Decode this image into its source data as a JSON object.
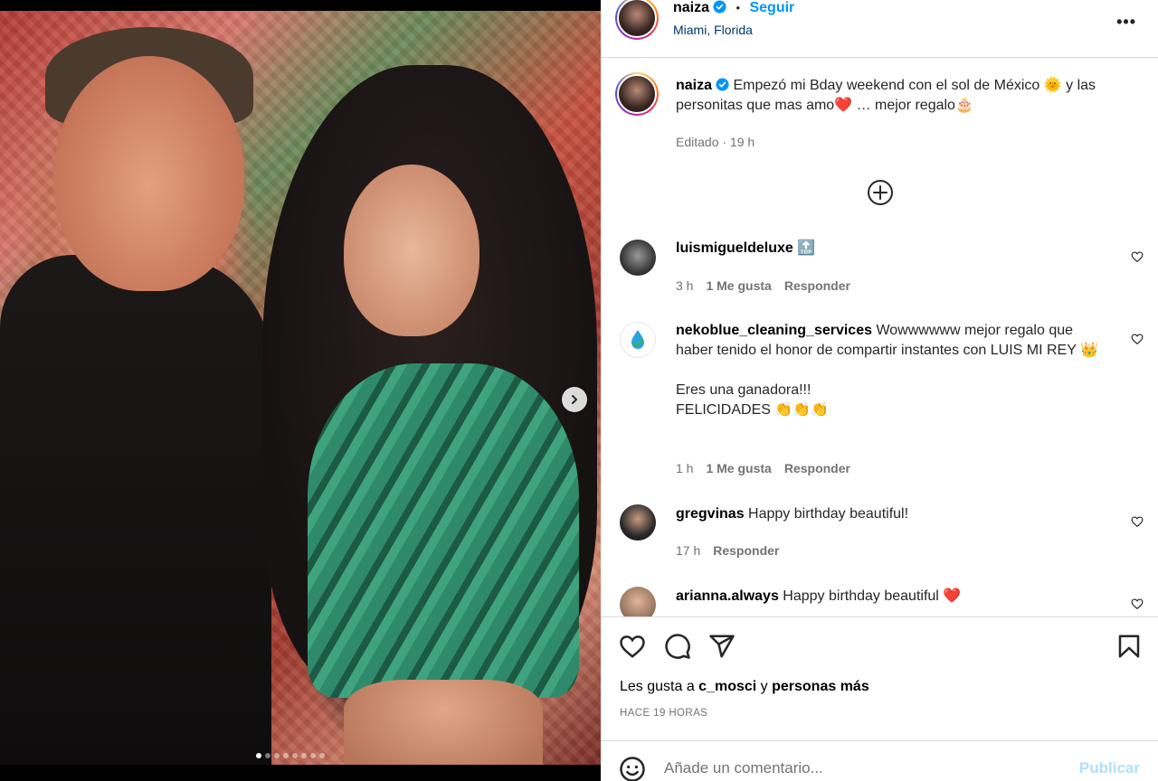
{
  "post": {
    "username": "naiza",
    "follow_label": "Seguir",
    "separator": "•",
    "location": "Miami, Florida",
    "more_label": "•••",
    "caption_username": "naiza",
    "caption_text": "Empezó mi Bday weekend con el sol de México 🌞 y las personitas que mas amo❤️ … mejor regalo🎂",
    "caption_meta": "Editado · 19 h",
    "load_more_icon": "plus-circle-icon",
    "media_slides": 8,
    "media_active_slide": 1
  },
  "comments": [
    {
      "username": "luismigueldeluxe",
      "text": "🔝",
      "time": "3 h",
      "likes": "1 Me gusta",
      "reply": "Responder"
    },
    {
      "username": "nekoblue_cleaning_services",
      "text": "Wowwwwww mejor regalo que haber tenido el honor de compartir instantes con LUIS MI REY 👑",
      "text2": "Eres una ganadora!!!",
      "text3": "FELICIDADES 👏👏👏",
      "time": "1 h",
      "likes": "1 Me gusta",
      "reply": "Responder"
    },
    {
      "username": "gregvinas",
      "text": "Happy birthday beautiful!",
      "time": "17 h",
      "reply": "Responder"
    },
    {
      "username": "arianna.always",
      "text": "Happy birthday beautiful ❤️"
    }
  ],
  "footer": {
    "likes_prefix": "Les gusta a ",
    "likes_user": "c_mosci",
    "likes_mid": " y ",
    "likes_rest": "personas más",
    "timestamp": "HACE 19 HORAS",
    "comment_placeholder": "Añade un comentario...",
    "publish_label": "Publicar"
  },
  "colors": {
    "accent": "#0095f6",
    "location": "#00376b",
    "muted": "#737373",
    "publish_disabled": "#b2dffc"
  }
}
